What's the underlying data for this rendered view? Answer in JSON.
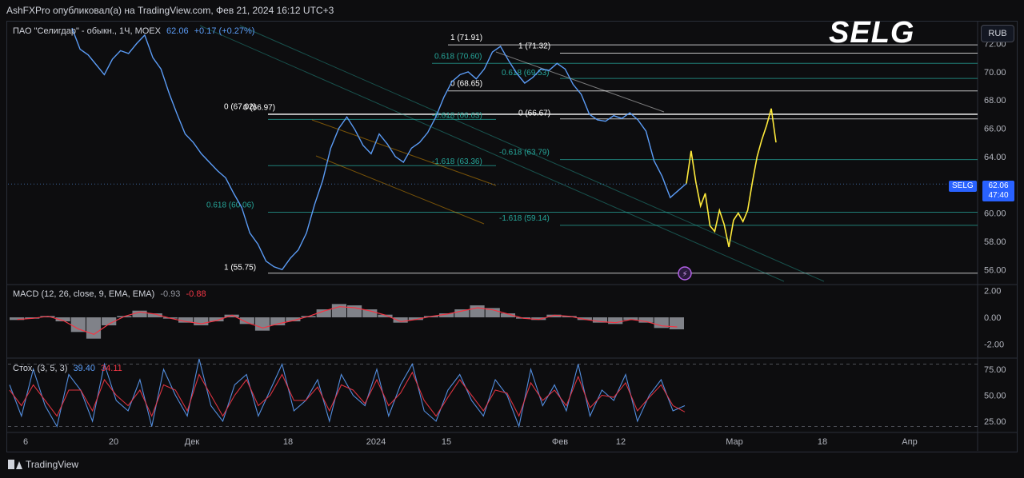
{
  "header": {
    "publish_line": "AshFXPro опубликовал(а) на TradingView.com, Фев 21, 2024 16:12 UTC+3"
  },
  "symbol": {
    "title": "ПАО \"Селигдар\" - обыкн., 1Ч, MOEX",
    "last": "62.06",
    "change": "+0.17 (+0.27%)",
    "ticker": "SELG",
    "currency": "RUB",
    "price_tag": "62.06",
    "countdown": "47:40",
    "watermark": "SELG"
  },
  "macd": {
    "title": "MACD (12, 26, close, 9, EMA, EMA)",
    "value1": "-0.93",
    "value2": "-0.88"
  },
  "stoch": {
    "title": "Стох. (3, 5, 3)",
    "value1": "39.40",
    "value2": "34.11"
  },
  "footer": {
    "brand": "TradingView"
  },
  "colors": {
    "background": "#0d0d0f",
    "price_line": "#5b9cf6",
    "projection": "#ffeb3b",
    "macd_line": "#f23645",
    "stoch_k": "#5b9cf6",
    "stoch_d": "#f23645",
    "fib_teal": "#26a69a"
  },
  "chart_data": [
    {
      "type": "line",
      "title": "SELG",
      "ylim": [
        55,
        73.5
      ],
      "y_ticks": [
        "72.00",
        "70.00",
        "68.00",
        "66.00",
        "64.00",
        "62.00",
        "60.00",
        "58.00",
        "56.00"
      ],
      "x_ticks": [
        "6",
        "20",
        "Дек",
        "18",
        "2024",
        "15",
        "Фев",
        "12",
        "Мар",
        "18",
        "Апр"
      ],
      "series": [
        {
          "values": [
            73.1,
            71.6,
            71.2,
            70.5,
            69.8,
            70.9,
            71.5,
            71.3,
            72.0,
            72.6,
            71.0,
            70.2,
            68.5,
            67.0,
            65.6,
            65.0,
            64.2,
            63.6,
            63.0,
            62.5,
            61.4,
            60.4,
            58.6,
            57.8,
            56.6,
            56.2,
            56.0,
            56.8,
            57.4,
            58.6,
            60.6,
            62.3,
            64.6,
            66.0,
            66.8,
            65.9,
            64.8,
            64.2,
            65.6,
            64.9,
            64.0,
            63.6,
            64.6,
            65.0,
            65.7,
            66.8,
            68.2,
            69.3,
            69.8,
            70.0,
            69.5,
            70.2,
            71.4,
            71.8,
            70.8,
            69.9,
            69.2,
            69.6,
            70.2,
            70.1,
            70.6,
            70.2,
            69.1,
            68.4,
            67.0,
            66.6,
            66.5,
            66.9,
            66.7,
            67.1,
            66.6,
            65.8,
            63.7,
            62.6,
            61.1,
            61.6,
            62.1
          ]
        },
        {
          "name": "",
          "values": [
            62.1,
            64.4,
            62.2,
            60.5,
            61.4,
            59.1,
            58.7,
            60.2,
            59.2,
            57.6,
            59.5,
            60.0,
            59.4,
            60.2,
            62.2,
            64.0,
            65.2,
            66.2,
            67.4,
            65.0
          ]
        }
      ],
      "fib_levels": [
        {
          "label": "1 (71.91)",
          "value": 71.91
        },
        {
          "label": "0.618 (70.60)",
          "value": 70.6
        },
        {
          "label": "0 (68.65)",
          "value": 68.65
        },
        {
          "label": "0 (67.02)",
          "value": 67.02
        },
        {
          "label": "0 (66.97)",
          "value": 66.97
        },
        {
          "label": "-0.618 (66.63)",
          "value": 66.63
        },
        {
          "label": "-1.618 (63.36)",
          "value": 63.36
        },
        {
          "label": "0.618 (60.06)",
          "value": 60.06
        },
        {
          "label": "1 (55.75)",
          "value": 55.75
        },
        {
          "label": "1 (71.32)",
          "value": 71.32
        },
        {
          "label": "0.618 (69.53)",
          "value": 69.53
        },
        {
          "label": "0 (66.67)",
          "value": 66.67
        },
        {
          "label": "-0.618 (63.79)",
          "value": 63.79
        },
        {
          "label": "-1.618 (59.14)",
          "value": 59.14
        }
      ]
    },
    {
      "type": "bar",
      "title": "MACD (12, 26, close, 9, EMA, EMA)",
      "ylim": [
        -3,
        2.4
      ],
      "y_ticks": [
        "2.00",
        "0.00",
        "-2.00"
      ],
      "series": [
        {
          "name": "MACD",
          "values": [
            -0.2,
            -0.1,
            0.1,
            -0.3,
            -1.1,
            -1.6,
            -0.6,
            0.1,
            0.5,
            0.3,
            -0.1,
            -0.4,
            -0.6,
            -0.3,
            0.2,
            -0.5,
            -1.0,
            -0.6,
            -0.3,
            0.1,
            0.6,
            1.0,
            0.9,
            0.6,
            0.2,
            -0.4,
            -0.2,
            0.1,
            0.3,
            0.6,
            0.9,
            0.7,
            0.3,
            -0.1,
            -0.2,
            0.2,
            0.1,
            -0.2,
            -0.4,
            -0.5,
            -0.2,
            -0.4,
            -0.8,
            -0.9
          ]
        }
      ]
    },
    {
      "type": "line",
      "title": "Стох. (3, 5, 3)",
      "ylim": [
        15,
        85
      ],
      "y_ticks": [
        "75.00",
        "50.00",
        "25.00"
      ],
      "series": [
        {
          "name": "%K",
          "values": [
            60,
            30,
            75,
            40,
            20,
            70,
            55,
            25,
            80,
            45,
            35,
            65,
            20,
            75,
            50,
            30,
            85,
            40,
            25,
            60,
            70,
            30,
            55,
            80,
            35,
            45,
            65,
            25,
            70,
            50,
            40,
            75,
            30,
            60,
            80,
            35,
            25,
            55,
            70,
            45,
            30,
            65,
            50,
            20,
            75,
            40,
            60,
            35,
            80,
            30,
            55,
            45,
            70,
            25,
            50,
            65,
            35,
            40
          ]
        },
        {
          "name": "%D",
          "values": [
            55,
            40,
            60,
            45,
            30,
            55,
            55,
            35,
            65,
            50,
            40,
            55,
            30,
            60,
            55,
            35,
            70,
            50,
            30,
            50,
            65,
            40,
            50,
            70,
            45,
            45,
            58,
            35,
            60,
            55,
            42,
            65,
            40,
            52,
            72,
            45,
            30,
            48,
            65,
            50,
            35,
            55,
            52,
            30,
            62,
            45,
            55,
            40,
            68,
            38,
            50,
            48,
            62,
            35,
            48,
            60,
            40,
            34
          ]
        }
      ]
    }
  ]
}
